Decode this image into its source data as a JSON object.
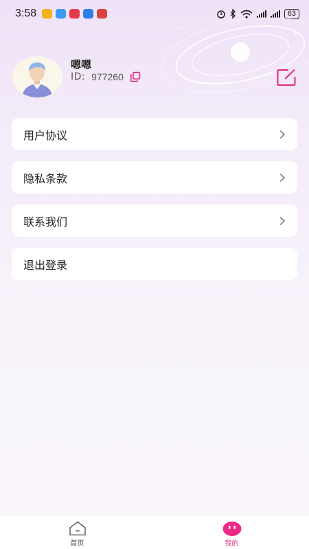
{
  "status_bar": {
    "time": "3:58",
    "battery": "63",
    "app_icons": [
      {
        "name": "weibo-icon",
        "color": "#f2b21f"
      },
      {
        "name": "chat-icon",
        "color": "#3a9bf0"
      },
      {
        "name": "heart-app-icon",
        "color": "#e63b4a"
      },
      {
        "name": "compass-app-icon",
        "color": "#2f7ee8"
      },
      {
        "name": "tomato-app-icon",
        "color": "#d9443a"
      }
    ]
  },
  "profile": {
    "nickname": "嗯嗯",
    "id_label": "ID:",
    "id_value": "977260"
  },
  "menu": {
    "items": [
      {
        "label": "用户协议",
        "has_arrow": true
      },
      {
        "label": "隐私条款",
        "has_arrow": true
      },
      {
        "label": "联系我们",
        "has_arrow": true
      },
      {
        "label": "退出登录",
        "has_arrow": false
      }
    ]
  },
  "tabbar": {
    "home_label": "首页",
    "mine_label": "我的",
    "active": "mine"
  },
  "colors": {
    "accent": "#e0257e",
    "card": "#ffffff",
    "text": "#222222"
  }
}
